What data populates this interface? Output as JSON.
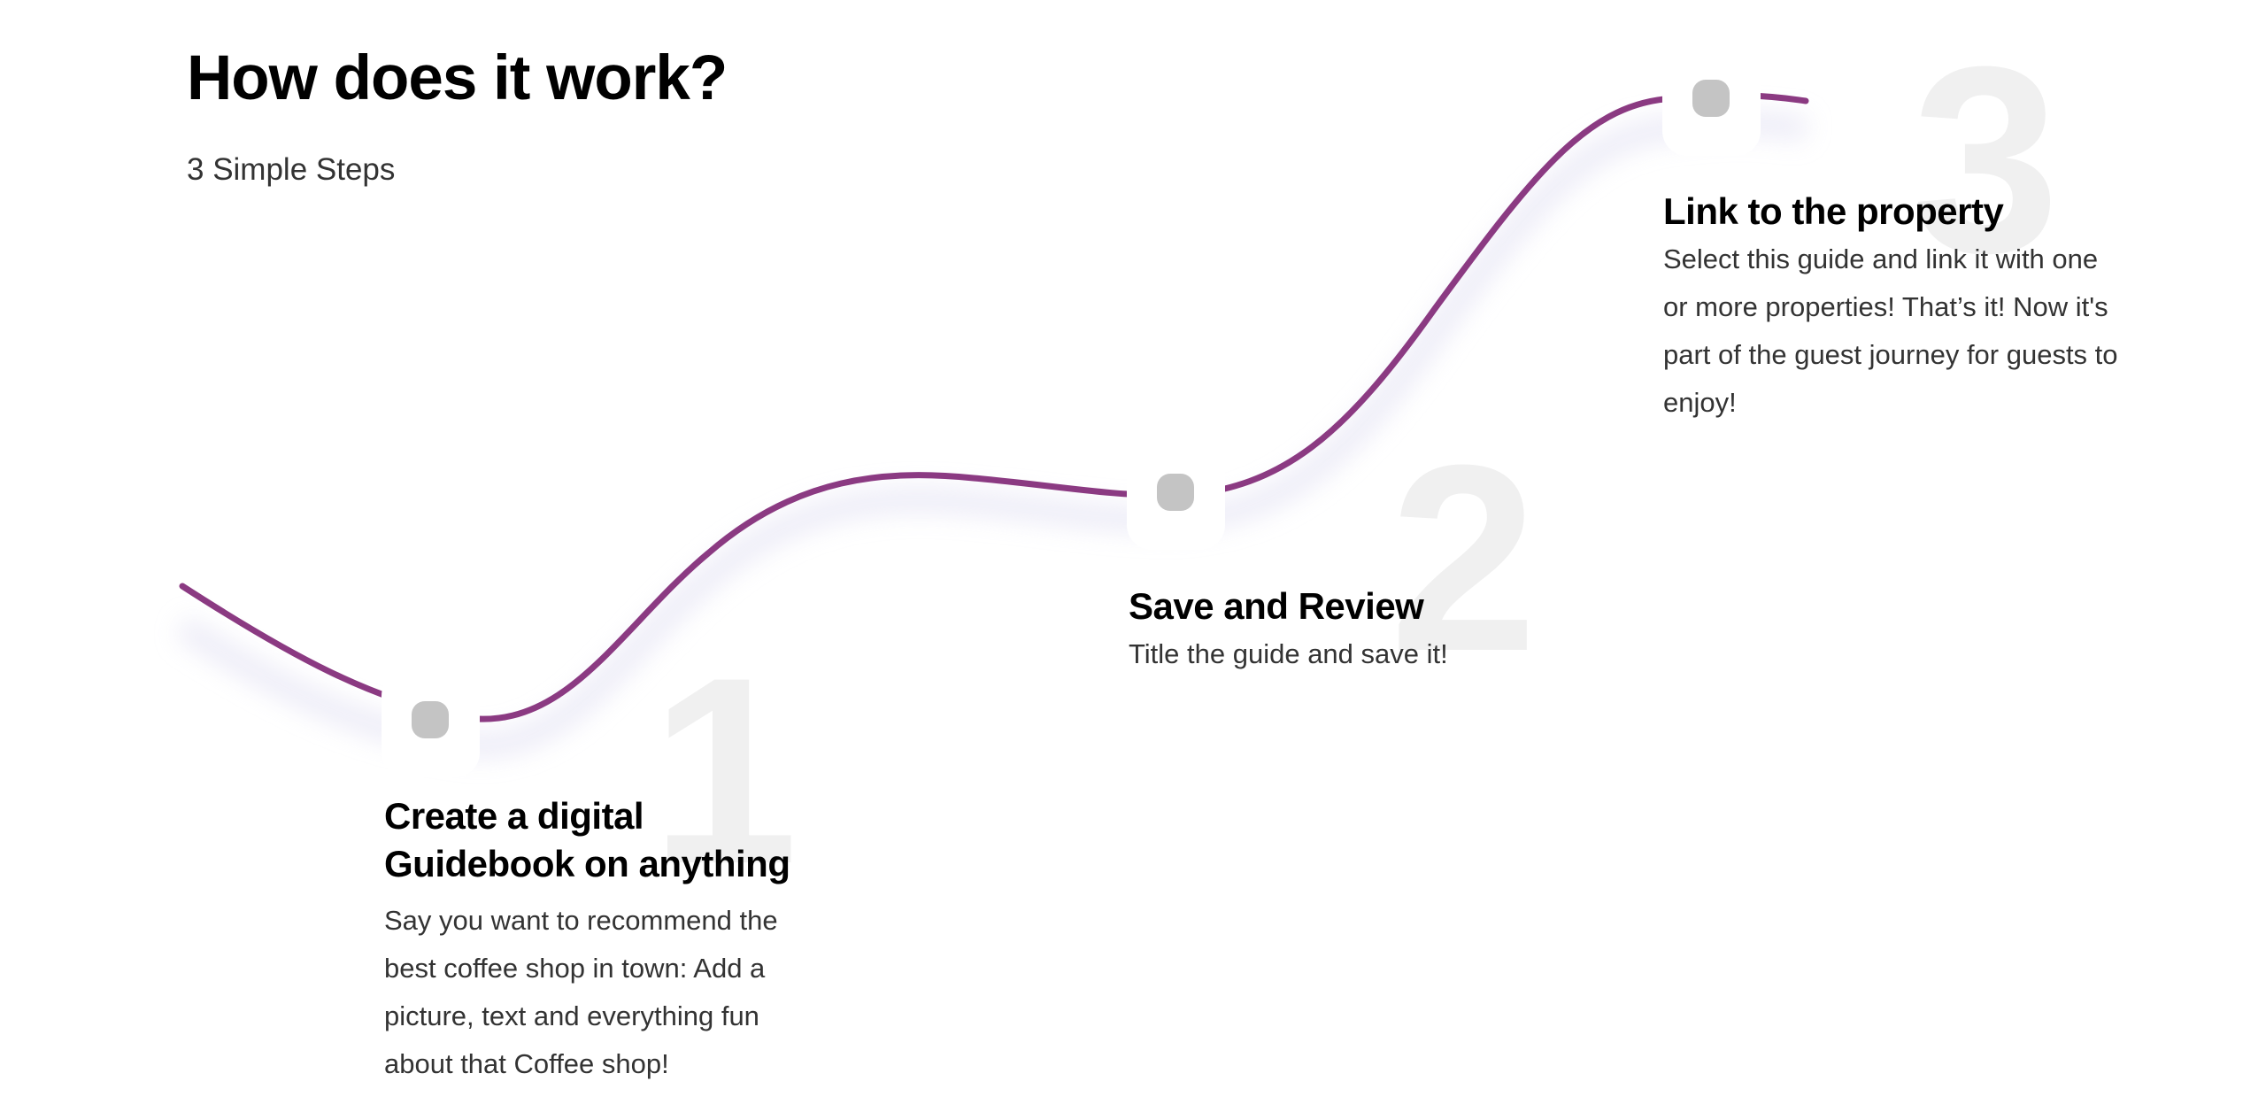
{
  "header": {
    "title": "How does it work?",
    "subtitle": "3 Simple Steps"
  },
  "steps": [
    {
      "number": "1",
      "title": "Create a digital Guidebook on anything",
      "description": "Say you want to recommend the best coffee shop in town: Add a picture, text and everything fun about that Coffee shop!"
    },
    {
      "number": "2",
      "title": "Save and Review",
      "description": "Title the guide and save it!"
    },
    {
      "number": "3",
      "title": "Link to the property",
      "description": "Select this guide and link it with one or more properties! That’s it! Now it's part of the guest journey for guests to enjoy!"
    }
  ],
  "colors": {
    "curve": "#8b3a82",
    "node_dot": "#c4c4c4",
    "big_number": "#f0f0f0",
    "title": "#000000",
    "text": "#333333"
  }
}
